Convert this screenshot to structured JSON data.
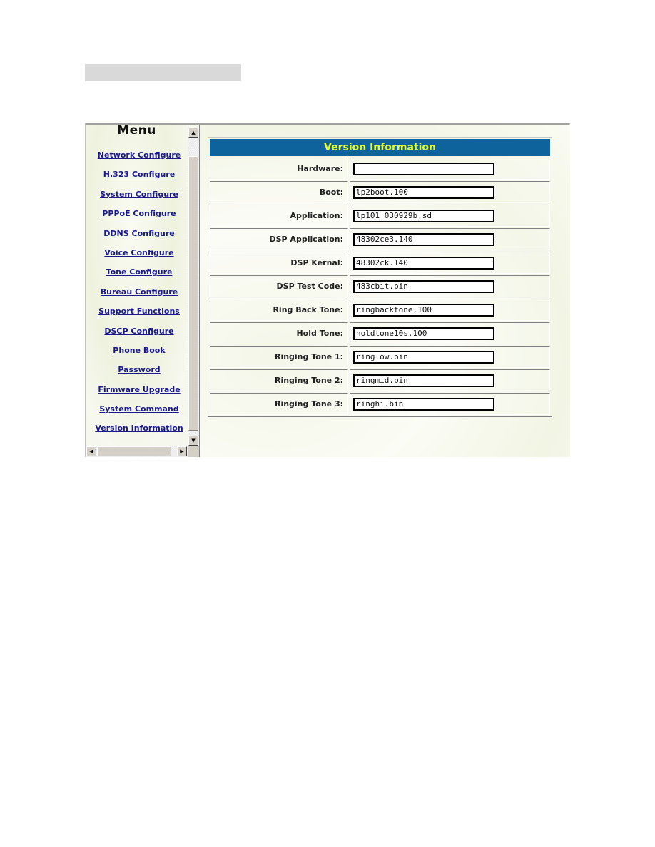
{
  "menu": {
    "title": "Menu",
    "items": [
      {
        "label": "Network Configure"
      },
      {
        "label": "H.323 Configure"
      },
      {
        "label": "System Configure"
      },
      {
        "label": "PPPoE Configure"
      },
      {
        "label": "DDNS Configure"
      },
      {
        "label": "Voice Configure"
      },
      {
        "label": "Tone Configure"
      },
      {
        "label": "Bureau Configure"
      },
      {
        "label": "Support Functions"
      },
      {
        "label": "DSCP Configure"
      },
      {
        "label": "Phone Book"
      },
      {
        "label": "Password"
      },
      {
        "label": "Firmware Upgrade"
      },
      {
        "label": "System Command"
      },
      {
        "label": "Version Information"
      }
    ]
  },
  "scrollbars": {
    "up_arrow": "▲",
    "down_arrow": "▼",
    "left_arrow": "◀",
    "right_arrow": "▶"
  },
  "version_info": {
    "title": "Version Information",
    "header_bg": "#0f639c",
    "header_text_color": "#e8ff2a",
    "rows": [
      {
        "label": "Hardware:",
        "value": ""
      },
      {
        "label": "Boot:",
        "value": "lp2boot.100"
      },
      {
        "label": "Application:",
        "value": "lp101_030929b.sd"
      },
      {
        "label": "DSP Application:",
        "value": "48302ce3.140"
      },
      {
        "label": "DSP Kernal:",
        "value": "48302ck.140"
      },
      {
        "label": "DSP Test Code:",
        "value": "483cbit.bin"
      },
      {
        "label": "Ring Back Tone:",
        "value": "ringbacktone.100"
      },
      {
        "label": "Hold Tone:",
        "value": "holdtone10s.100"
      },
      {
        "label": "Ringing Tone 1:",
        "value": "ringlow.bin"
      },
      {
        "label": "Ringing Tone 2:",
        "value": "ringmid.bin"
      },
      {
        "label": "Ringing Tone 3:",
        "value": "ringhi.bin"
      }
    ]
  }
}
